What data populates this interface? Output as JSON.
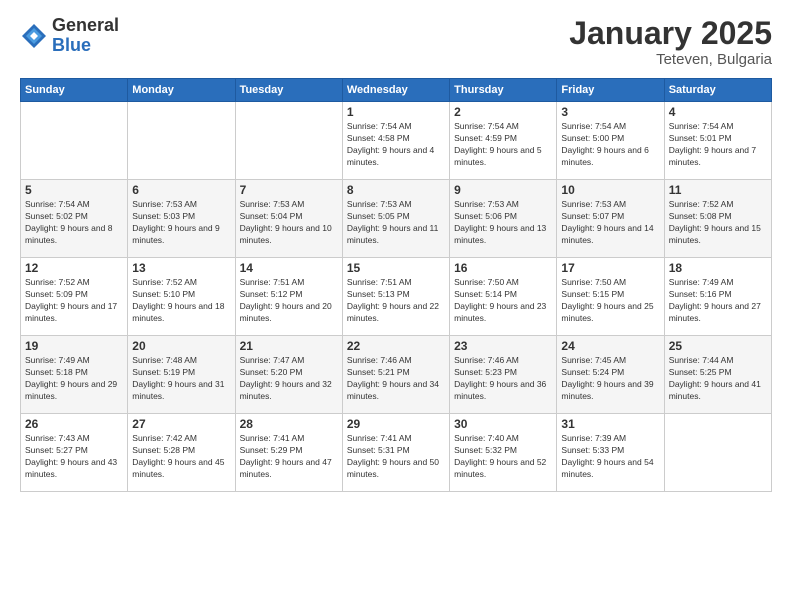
{
  "logo": {
    "general": "General",
    "blue": "Blue"
  },
  "title": "January 2025",
  "subtitle": "Teteven, Bulgaria",
  "weekdays": [
    "Sunday",
    "Monday",
    "Tuesday",
    "Wednesday",
    "Thursday",
    "Friday",
    "Saturday"
  ],
  "weeks": [
    [
      {
        "day": "",
        "sunrise": "",
        "sunset": "",
        "daylight": ""
      },
      {
        "day": "",
        "sunrise": "",
        "sunset": "",
        "daylight": ""
      },
      {
        "day": "",
        "sunrise": "",
        "sunset": "",
        "daylight": ""
      },
      {
        "day": "1",
        "sunrise": "Sunrise: 7:54 AM",
        "sunset": "Sunset: 4:58 PM",
        "daylight": "Daylight: 9 hours and 4 minutes."
      },
      {
        "day": "2",
        "sunrise": "Sunrise: 7:54 AM",
        "sunset": "Sunset: 4:59 PM",
        "daylight": "Daylight: 9 hours and 5 minutes."
      },
      {
        "day": "3",
        "sunrise": "Sunrise: 7:54 AM",
        "sunset": "Sunset: 5:00 PM",
        "daylight": "Daylight: 9 hours and 6 minutes."
      },
      {
        "day": "4",
        "sunrise": "Sunrise: 7:54 AM",
        "sunset": "Sunset: 5:01 PM",
        "daylight": "Daylight: 9 hours and 7 minutes."
      }
    ],
    [
      {
        "day": "5",
        "sunrise": "Sunrise: 7:54 AM",
        "sunset": "Sunset: 5:02 PM",
        "daylight": "Daylight: 9 hours and 8 minutes."
      },
      {
        "day": "6",
        "sunrise": "Sunrise: 7:53 AM",
        "sunset": "Sunset: 5:03 PM",
        "daylight": "Daylight: 9 hours and 9 minutes."
      },
      {
        "day": "7",
        "sunrise": "Sunrise: 7:53 AM",
        "sunset": "Sunset: 5:04 PM",
        "daylight": "Daylight: 9 hours and 10 minutes."
      },
      {
        "day": "8",
        "sunrise": "Sunrise: 7:53 AM",
        "sunset": "Sunset: 5:05 PM",
        "daylight": "Daylight: 9 hours and 11 minutes."
      },
      {
        "day": "9",
        "sunrise": "Sunrise: 7:53 AM",
        "sunset": "Sunset: 5:06 PM",
        "daylight": "Daylight: 9 hours and 13 minutes."
      },
      {
        "day": "10",
        "sunrise": "Sunrise: 7:53 AM",
        "sunset": "Sunset: 5:07 PM",
        "daylight": "Daylight: 9 hours and 14 minutes."
      },
      {
        "day": "11",
        "sunrise": "Sunrise: 7:52 AM",
        "sunset": "Sunset: 5:08 PM",
        "daylight": "Daylight: 9 hours and 15 minutes."
      }
    ],
    [
      {
        "day": "12",
        "sunrise": "Sunrise: 7:52 AM",
        "sunset": "Sunset: 5:09 PM",
        "daylight": "Daylight: 9 hours and 17 minutes."
      },
      {
        "day": "13",
        "sunrise": "Sunrise: 7:52 AM",
        "sunset": "Sunset: 5:10 PM",
        "daylight": "Daylight: 9 hours and 18 minutes."
      },
      {
        "day": "14",
        "sunrise": "Sunrise: 7:51 AM",
        "sunset": "Sunset: 5:12 PM",
        "daylight": "Daylight: 9 hours and 20 minutes."
      },
      {
        "day": "15",
        "sunrise": "Sunrise: 7:51 AM",
        "sunset": "Sunset: 5:13 PM",
        "daylight": "Daylight: 9 hours and 22 minutes."
      },
      {
        "day": "16",
        "sunrise": "Sunrise: 7:50 AM",
        "sunset": "Sunset: 5:14 PM",
        "daylight": "Daylight: 9 hours and 23 minutes."
      },
      {
        "day": "17",
        "sunrise": "Sunrise: 7:50 AM",
        "sunset": "Sunset: 5:15 PM",
        "daylight": "Daylight: 9 hours and 25 minutes."
      },
      {
        "day": "18",
        "sunrise": "Sunrise: 7:49 AM",
        "sunset": "Sunset: 5:16 PM",
        "daylight": "Daylight: 9 hours and 27 minutes."
      }
    ],
    [
      {
        "day": "19",
        "sunrise": "Sunrise: 7:49 AM",
        "sunset": "Sunset: 5:18 PM",
        "daylight": "Daylight: 9 hours and 29 minutes."
      },
      {
        "day": "20",
        "sunrise": "Sunrise: 7:48 AM",
        "sunset": "Sunset: 5:19 PM",
        "daylight": "Daylight: 9 hours and 31 minutes."
      },
      {
        "day": "21",
        "sunrise": "Sunrise: 7:47 AM",
        "sunset": "Sunset: 5:20 PM",
        "daylight": "Daylight: 9 hours and 32 minutes."
      },
      {
        "day": "22",
        "sunrise": "Sunrise: 7:46 AM",
        "sunset": "Sunset: 5:21 PM",
        "daylight": "Daylight: 9 hours and 34 minutes."
      },
      {
        "day": "23",
        "sunrise": "Sunrise: 7:46 AM",
        "sunset": "Sunset: 5:23 PM",
        "daylight": "Daylight: 9 hours and 36 minutes."
      },
      {
        "day": "24",
        "sunrise": "Sunrise: 7:45 AM",
        "sunset": "Sunset: 5:24 PM",
        "daylight": "Daylight: 9 hours and 39 minutes."
      },
      {
        "day": "25",
        "sunrise": "Sunrise: 7:44 AM",
        "sunset": "Sunset: 5:25 PM",
        "daylight": "Daylight: 9 hours and 41 minutes."
      }
    ],
    [
      {
        "day": "26",
        "sunrise": "Sunrise: 7:43 AM",
        "sunset": "Sunset: 5:27 PM",
        "daylight": "Daylight: 9 hours and 43 minutes."
      },
      {
        "day": "27",
        "sunrise": "Sunrise: 7:42 AM",
        "sunset": "Sunset: 5:28 PM",
        "daylight": "Daylight: 9 hours and 45 minutes."
      },
      {
        "day": "28",
        "sunrise": "Sunrise: 7:41 AM",
        "sunset": "Sunset: 5:29 PM",
        "daylight": "Daylight: 9 hours and 47 minutes."
      },
      {
        "day": "29",
        "sunrise": "Sunrise: 7:41 AM",
        "sunset": "Sunset: 5:31 PM",
        "daylight": "Daylight: 9 hours and 50 minutes."
      },
      {
        "day": "30",
        "sunrise": "Sunrise: 7:40 AM",
        "sunset": "Sunset: 5:32 PM",
        "daylight": "Daylight: 9 hours and 52 minutes."
      },
      {
        "day": "31",
        "sunrise": "Sunrise: 7:39 AM",
        "sunset": "Sunset: 5:33 PM",
        "daylight": "Daylight: 9 hours and 54 minutes."
      },
      {
        "day": "",
        "sunrise": "",
        "sunset": "",
        "daylight": ""
      }
    ]
  ]
}
